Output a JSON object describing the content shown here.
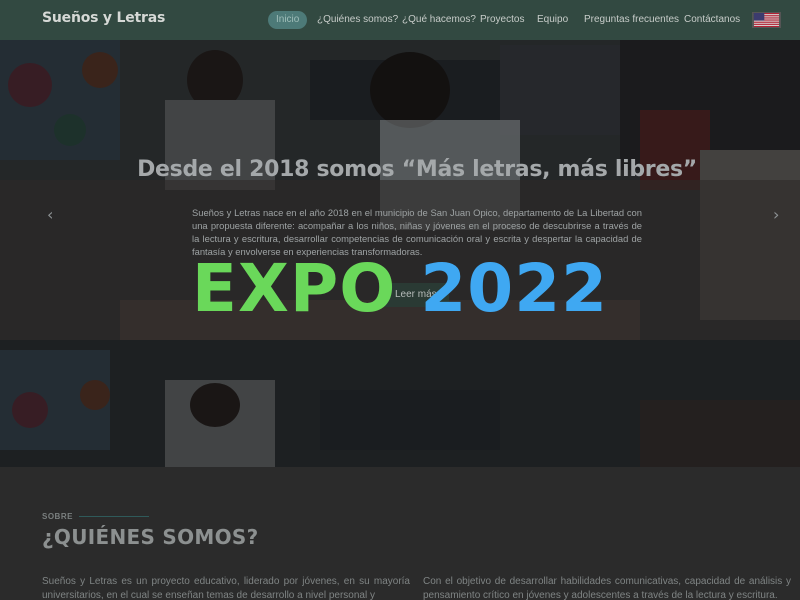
{
  "brand": "Sueños y Letras",
  "nav": {
    "items": [
      {
        "label": "Inicio",
        "active": true
      },
      {
        "label": "¿Quiénes somos?",
        "active": false
      },
      {
        "label": "¿Qué hacemos?",
        "active": false
      },
      {
        "label": "Proyectos",
        "active": false
      },
      {
        "label": "Equipo",
        "active": false
      },
      {
        "label": "Preguntas frecuentes",
        "active": false
      },
      {
        "label": "Contáctanos",
        "active": false
      }
    ],
    "language_flag_icon": "us-flag-icon"
  },
  "hero": {
    "title": "Desde el 2018 somos “Más letras, más libres”",
    "text": "Sueños y Letras nace en el año 2018 en el municipio de San Juan Opico, departamento de La Libertad con una propuesta diferente: acompañar a los niños, niñas y jóvenes en el proceso de descubrirse a través de la lectura y escritura, desarrollar competencias de comunicación oral y escrita y despertar la capacidad de fantasía y envolverse en experiencias transformadoras.",
    "button_label": "Leer más",
    "prev_icon": "chevron-left-icon",
    "next_icon": "chevron-right-icon",
    "prev_glyph": "‹",
    "next_glyph": "›"
  },
  "expo": {
    "word": "EXPO",
    "year": "2022",
    "word_color": "#6ad85a",
    "year_color": "#3fa8f2"
  },
  "about": {
    "kicker": "SOBRE",
    "title": "¿QUIÉNES SOMOS?",
    "col_left": "Sueños y Letras es un proyecto educativo, liderado por jóvenes, en su mayoría universitarios, en el cual se enseñan temas de desarrollo a nivel personal y",
    "col_right": "Con el objetivo de desarrollar habilidades comunicativas, capacidad de análisis y pensamiento crítico en jóvenes y adolescentes a través de la lectura y escritura."
  },
  "colors": {
    "navbar": "#344e44",
    "nav_active": "#4d7a78",
    "page_bg": "#2b2b2b"
  }
}
